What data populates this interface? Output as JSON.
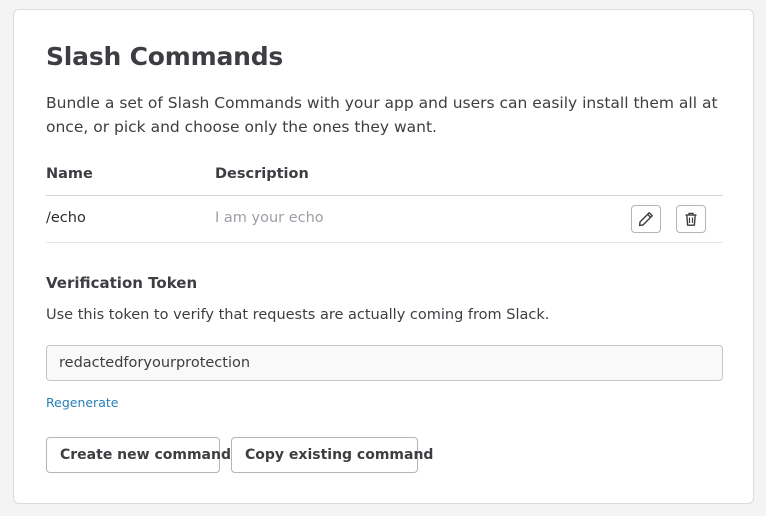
{
  "section": {
    "title": "Slash Commands",
    "description": "Bundle a set of Slash Commands with your app and users can easily install them all at once, or pick and choose only the ones they want."
  },
  "table": {
    "columns": [
      "Name",
      "Description"
    ],
    "rows": [
      {
        "name": "/echo",
        "description": "I am your echo",
        "edit_icon": "pencil-icon",
        "delete_icon": "trash-icon"
      }
    ]
  },
  "verification": {
    "title": "Verification Token",
    "help": "Use this token to verify that requests are actually coming from Slack.",
    "token_value": "redactedforyourprotection",
    "regenerate_label": "Regenerate"
  },
  "actions": {
    "create_label": "Create new command",
    "copy_label": "Copy existing command"
  },
  "colors": {
    "link": "#2a80b9",
    "muted_text": "#9e9ea6",
    "text": "#3d3e42",
    "border": "#b5b5b8"
  }
}
